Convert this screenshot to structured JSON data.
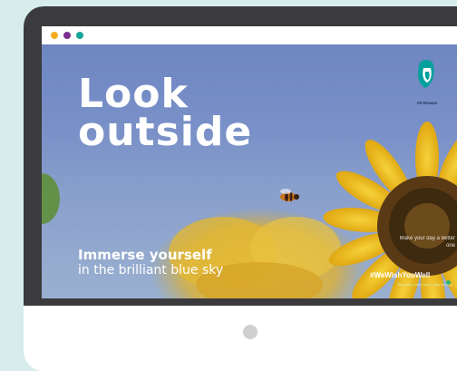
{
  "window": {
    "dots": [
      {
        "name": "yellow-dot",
        "color": "#f2b01e"
      },
      {
        "name": "purple-dot",
        "color": "#7b2f8e"
      },
      {
        "name": "teal-dot",
        "color": "#16a596"
      }
    ]
  },
  "ad": {
    "headline_line1": "Look",
    "headline_line2": "outside",
    "sub_bold": "Immerse yourself",
    "sub_light": "in the brilliant blue sky",
    "brand": "PETRONAS",
    "side_note": "Make your day a better one",
    "hashtag": "#WeWishYouWell",
    "tagline": "Stay safe, stay home, stay healthy"
  },
  "colors": {
    "page_background": "#d7edec",
    "bezel": "#3b3b3d",
    "chin": "#ffffff",
    "sky": "#7a91c8",
    "brand_green": "#00a19c",
    "sunflower_yellow": "#f3c318"
  },
  "icons": {
    "logo": "petronas-logo-icon",
    "power": "power-button-icon"
  }
}
